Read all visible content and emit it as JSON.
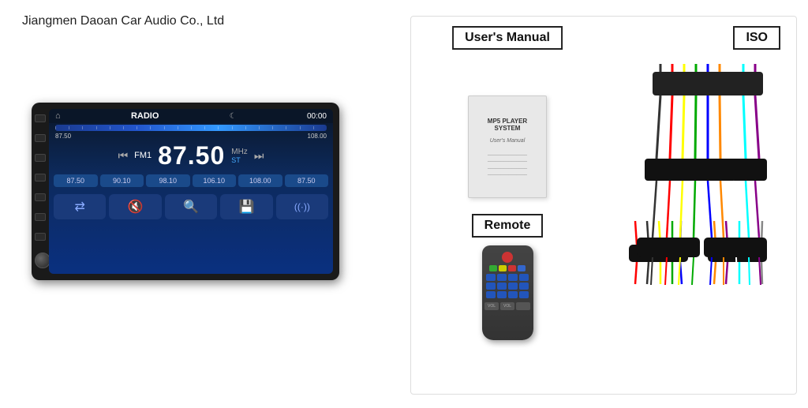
{
  "company": {
    "name": "Jiangmen Daoan Car Audio Co., Ltd"
  },
  "radio": {
    "mode": "RADIO",
    "time": "00:00",
    "freq_start": "87.50",
    "freq_end": "108.00",
    "fm_label": "FM1",
    "main_freq": "87.50",
    "unit": "MHz",
    "stereo": "ST",
    "presets": [
      "87.50",
      "90.10",
      "98.10",
      "106.10",
      "108.00",
      "87.50"
    ],
    "func_buttons": [
      "⇄",
      "🔇",
      "🔍",
      "💾",
      "((·))"
    ]
  },
  "manual": {
    "label": "User's Manual",
    "book_title": "MP5 PLAYER SYSTEM",
    "book_subtitle": "",
    "book_text": "User's Manual"
  },
  "iso": {
    "label": "ISO"
  },
  "remote": {
    "label": "Remote"
  }
}
